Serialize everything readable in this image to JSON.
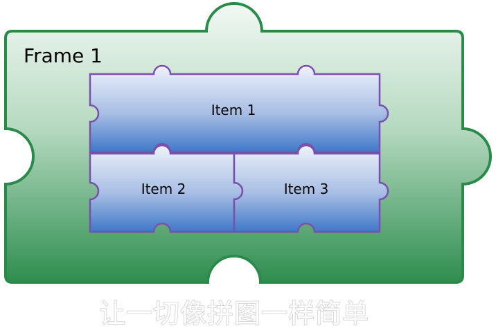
{
  "frame": {
    "title": "Frame 1",
    "fill_top": "#f2f8f4",
    "fill_bottom": "#2e8d4e",
    "border": "#2a8a4a"
  },
  "items": [
    {
      "label": "Item 1"
    },
    {
      "label": "Item 2"
    },
    {
      "label": "Item 3"
    }
  ],
  "item_style": {
    "fill_top": "#eef2fb",
    "fill_bottom": "#3f78c8",
    "border": "#7b4fb0"
  },
  "caption": "让一切像拼图一样简单"
}
